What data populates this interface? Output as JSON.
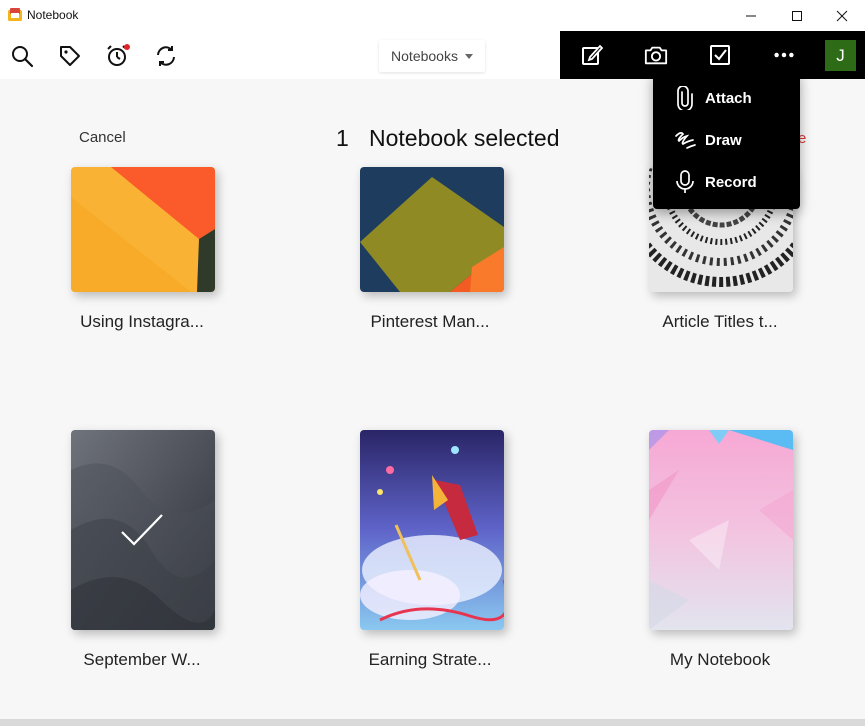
{
  "window": {
    "title": "Notebook"
  },
  "toolbar": {
    "notebooks_dropdown": "Notebooks",
    "avatar_initial": "J"
  },
  "selection": {
    "cancel_label": "Cancel",
    "count": "1",
    "label": "Notebook selected"
  },
  "more_menu": {
    "items": [
      {
        "label": "Attach",
        "icon": "paperclip-icon"
      },
      {
        "label": "Draw",
        "icon": "draw-icon"
      },
      {
        "label": "Record",
        "icon": "microphone-icon"
      }
    ]
  },
  "notebooks": [
    {
      "title": "Using Instagra...",
      "selected": false
    },
    {
      "title": "Pinterest Man...",
      "selected": false
    },
    {
      "title": "Article Titles t...",
      "selected": false
    },
    {
      "title": "September W...",
      "selected": true
    },
    {
      "title": "Earning Strate...",
      "selected": false
    },
    {
      "title": "My Notebook",
      "selected": false
    }
  ],
  "colors": {
    "accent_dark": "#000000",
    "avatar_bg": "#2e6b16",
    "delete_red": "#d43b3b"
  }
}
